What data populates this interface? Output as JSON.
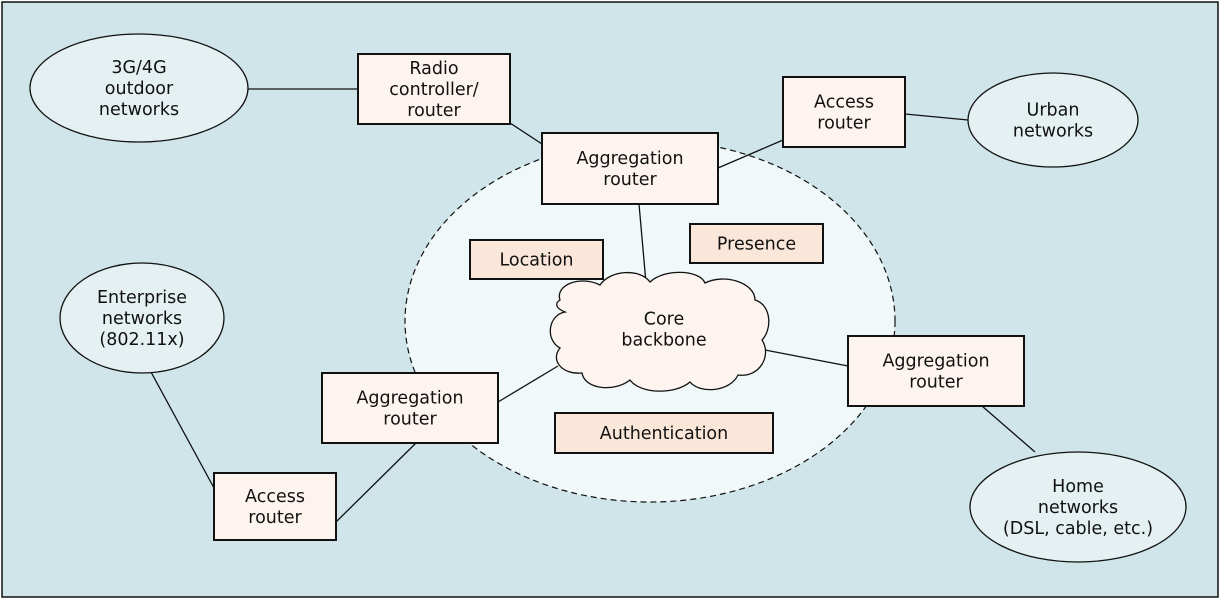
{
  "colors": {
    "background": "#cfe5e9",
    "core_region": "#f1f8f9",
    "network_fill": "#e5f0f2",
    "router_fill": "#fdf4ef",
    "service_fill": "#fbe7d9",
    "cloud_fill": "#fdf4ef",
    "stroke": "#111111"
  },
  "networks": [
    {
      "id": "outdoor",
      "lines": [
        "3G/4G",
        "outdoor",
        "networks"
      ]
    },
    {
      "id": "urban",
      "lines": [
        "Urban",
        "networks"
      ]
    },
    {
      "id": "enterprise",
      "lines": [
        "Enterprise",
        "networks",
        "(802.11x)"
      ]
    },
    {
      "id": "home",
      "lines": [
        "Home",
        "networks",
        "(DSL, cable, etc.)"
      ]
    }
  ],
  "routers": [
    {
      "id": "radio",
      "lines": [
        "Radio",
        "controller/",
        "router"
      ]
    },
    {
      "id": "access-top",
      "lines": [
        "Access",
        "router"
      ]
    },
    {
      "id": "agg-top",
      "lines": [
        "Aggregation",
        "router"
      ]
    },
    {
      "id": "agg-left",
      "lines": [
        "Aggregation",
        "router"
      ]
    },
    {
      "id": "agg-right",
      "lines": [
        "Aggregation",
        "router"
      ]
    },
    {
      "id": "access-bottom",
      "lines": [
        "Access",
        "router"
      ]
    }
  ],
  "services": [
    {
      "id": "location",
      "label": "Location"
    },
    {
      "id": "presence",
      "label": "Presence"
    },
    {
      "id": "authentication",
      "label": "Authentication"
    }
  ],
  "core": {
    "lines": [
      "Core",
      "backbone"
    ]
  },
  "connections": [
    [
      "outdoor",
      "radio"
    ],
    [
      "radio",
      "agg-top"
    ],
    [
      "agg-top",
      "access-top"
    ],
    [
      "access-top",
      "urban"
    ],
    [
      "agg-top",
      "core"
    ],
    [
      "core",
      "agg-right"
    ],
    [
      "agg-right",
      "home"
    ],
    [
      "core",
      "agg-left"
    ],
    [
      "agg-left",
      "access-bottom"
    ],
    [
      "enterprise",
      "access-bottom"
    ]
  ]
}
